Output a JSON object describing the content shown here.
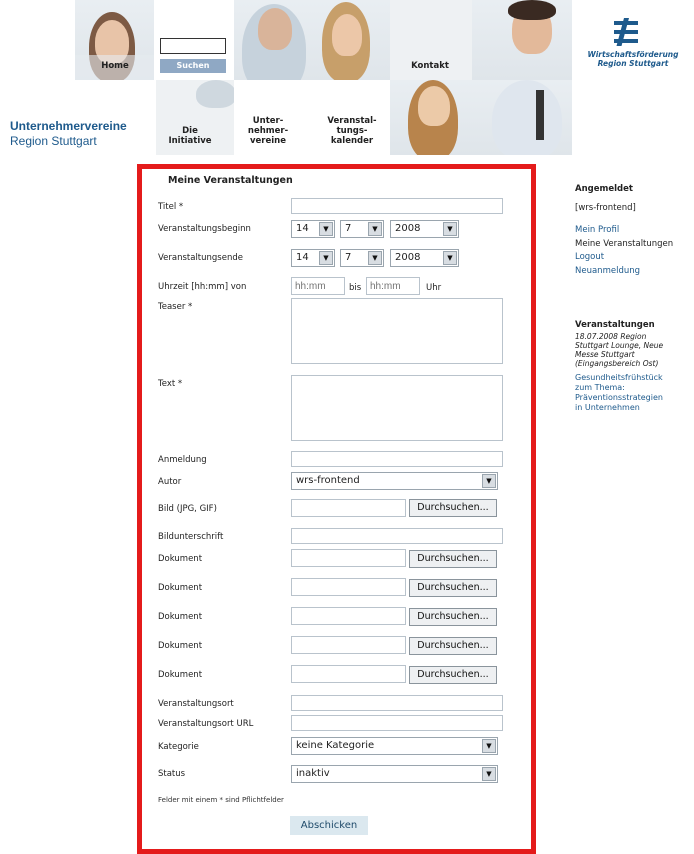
{
  "header": {
    "nav": {
      "home": "Home",
      "search_button": "Suchen",
      "kontakt": "Kontakt",
      "initiative": [
        "Die",
        "Initiative"
      ],
      "vereine": [
        "Unter-",
        "nehmer-",
        "vereine"
      ],
      "kalender": [
        "Veranstal-",
        "tungs-",
        "kalender"
      ]
    },
    "logo_text": [
      "Wirtschaftsförderung",
      "Region Stuttgart"
    ],
    "brand": [
      "Unternehmervereine",
      "Region Stuttgart"
    ]
  },
  "form": {
    "heading": "Meine Veranstaltungen",
    "labels": {
      "titel": "Titel *",
      "beginn": "Veranstaltungsbeginn",
      "ende": "Veranstaltungsende",
      "uhrzeit": "Uhrzeit [hh:mm] von",
      "bis": "bis",
      "uhr": "Uhr",
      "teaser": "Teaser *",
      "text": "Text *",
      "anmeldung": "Anmeldung",
      "autor": "Autor",
      "bild": "Bild (JPG, GIF)",
      "bildunterschrift": "Bildunterschrift",
      "dokument": "Dokument",
      "ort": "Veranstaltungsort",
      "ort_url": "Veranstaltungsort URL",
      "kategorie": "Kategorie",
      "status": "Status"
    },
    "beginn": {
      "day": "14",
      "month": "7",
      "year": "2008"
    },
    "ende": {
      "day": "14",
      "month": "7",
      "year": "2008"
    },
    "time_from_placeholder": "hh:mm",
    "time_to_placeholder": "hh:mm",
    "autor_value": "wrs-frontend",
    "browse_label": "Durchsuchen...",
    "kategorie_value": "keine Kategorie",
    "status_value": "inaktiv",
    "footnote": "Felder mit einem * sind Pflichtfelder",
    "submit_label": "Abschicken"
  },
  "sidebar": {
    "logged_in_title": "Angemeldet",
    "user": "[wrs-frontend]",
    "links": [
      "Mein Profil",
      "Meine Veranstaltungen",
      "Logout",
      "Neuanmeldung"
    ],
    "events_title": "Veranstaltungen",
    "event_info": [
      "18.07.2008 Region",
      "Stuttgart Lounge, Neue",
      "Messe Stuttgart",
      "(Eingangsbereich Ost)"
    ],
    "event_link": [
      "Gesundheitsfrühstück",
      "zum Thema:",
      "Präventionsstrategien",
      "in Unternehmen"
    ]
  }
}
